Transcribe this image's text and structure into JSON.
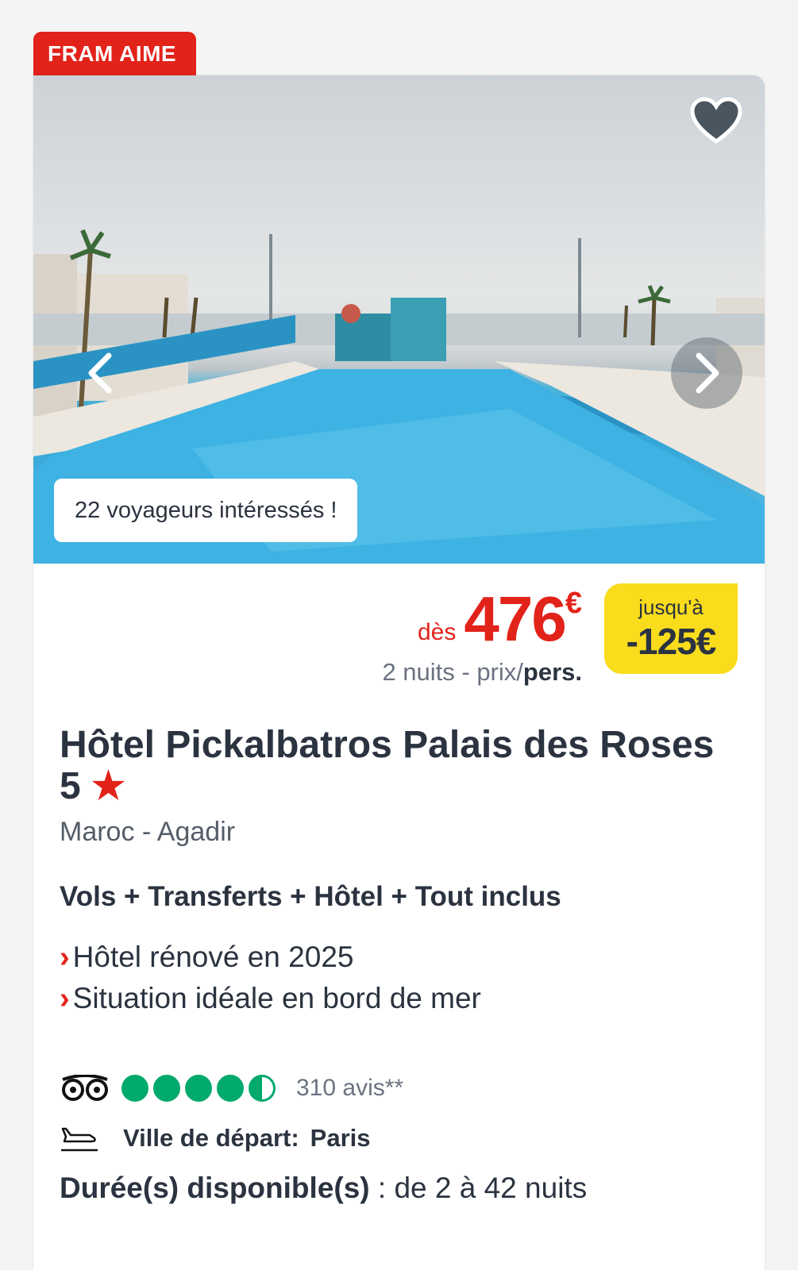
{
  "badge": {
    "label": "FRAM AIME"
  },
  "photo": {
    "interest_text": "22 voyageurs intéressés !",
    "icons": {
      "favorite": "heart-icon",
      "prev": "chevron-left-icon",
      "next": "chevron-right-icon"
    }
  },
  "price": {
    "prefix": "dès",
    "amount": "476",
    "currency": "€",
    "sub_text": "2 nuits - prix/",
    "sub_bold": "pers."
  },
  "discount": {
    "label": "jusqu'à",
    "amount": "-125€"
  },
  "hotel": {
    "name": "Hôtel Pickalbatros Palais des Roses 5",
    "star": "★",
    "location": "Maroc - Agadir",
    "formula": "Vols + Transferts + Hôtel + Tout inclus",
    "features": [
      "Hôtel rénové en 2025",
      "Situation idéale en bord de mer"
    ]
  },
  "reviews": {
    "rating": 4.5,
    "max": 5,
    "count_text": "310 avis**",
    "icon": "tripadvisor-icon"
  },
  "departure": {
    "label": "Ville de départ:",
    "city": "Paris",
    "icon": "plane-departure-icon"
  },
  "durations": {
    "label": "Durée(s) disponible(s)",
    "value": " : de 2 à 42 nuits"
  },
  "colors": {
    "accent": "#e2231a",
    "discount_bg": "#f9dc1c",
    "rating": "#00aa6c",
    "text": "#2b3340"
  }
}
